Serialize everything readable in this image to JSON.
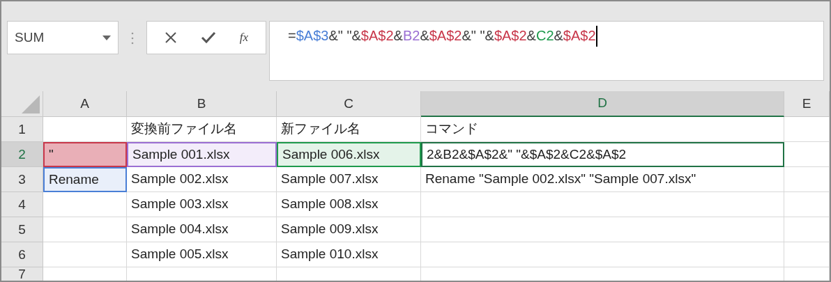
{
  "name_box": {
    "value": "SUM"
  },
  "function_button": {
    "label": "fx"
  },
  "formula": [
    {
      "text": "=",
      "color": "#404040"
    },
    {
      "text": "$A$3",
      "color": "#4a7fd6"
    },
    {
      "text": "&\" \"&",
      "color": "#404040"
    },
    {
      "text": "$A$2",
      "color": "#c8374a"
    },
    {
      "text": "&",
      "color": "#404040"
    },
    {
      "text": "B2",
      "color": "#9b6fd3"
    },
    {
      "text": "&",
      "color": "#404040"
    },
    {
      "text": "$A$2",
      "color": "#c8374a"
    },
    {
      "text": "&\" \"&",
      "color": "#404040"
    },
    {
      "text": "$A$2",
      "color": "#c8374a"
    },
    {
      "text": "&",
      "color": "#404040"
    },
    {
      "text": "C2",
      "color": "#1e9a4c"
    },
    {
      "text": "&",
      "color": "#404040"
    },
    {
      "text": "$A$2",
      "color": "#c8374a"
    }
  ],
  "columns": [
    {
      "label": "A",
      "selected": false
    },
    {
      "label": "B",
      "selected": false
    },
    {
      "label": "C",
      "selected": false
    },
    {
      "label": "D",
      "selected": true
    },
    {
      "label": "E",
      "selected": false
    }
  ],
  "rows": [
    {
      "label": "1",
      "selected": false,
      "cells": [
        {},
        {
          "text": "変換前ファイル名"
        },
        {
          "text": "新ファイル名"
        },
        {
          "text": "コマンド"
        },
        {}
      ]
    },
    {
      "label": "2",
      "selected": true,
      "cells": [
        {
          "text": "\"",
          "color": "#c8374a"
        },
        {
          "text": "Sample 001.xlsx",
          "color": "#9b6fd3"
        },
        {
          "text": "Sample 006.xlsx",
          "color": "#1e9a4c"
        },
        {
          "text": "2&B2&$A$2&\" \"&$A$2&C2&$A$2",
          "selected": true
        },
        {}
      ]
    },
    {
      "label": "3",
      "selected": false,
      "cells": [
        {
          "text": "Rename",
          "color": "#4a7fd6"
        },
        {
          "text": "Sample 002.xlsx"
        },
        {
          "text": "Sample 007.xlsx"
        },
        {
          "text": "Rename \"Sample 002.xlsx\" \"Sample 007.xlsx\""
        },
        {}
      ]
    },
    {
      "label": "4",
      "selected": false,
      "cells": [
        {},
        {
          "text": "Sample 003.xlsx"
        },
        {
          "text": "Sample 008.xlsx"
        },
        {},
        {}
      ]
    },
    {
      "label": "5",
      "selected": false,
      "cells": [
        {},
        {
          "text": "Sample 004.xlsx"
        },
        {
          "text": "Sample 009.xlsx"
        },
        {},
        {}
      ]
    },
    {
      "label": "6",
      "selected": false,
      "cells": [
        {},
        {
          "text": "Sample 005.xlsx"
        },
        {
          "text": "Sample 010.xlsx"
        },
        {},
        {}
      ]
    },
    {
      "label": "7",
      "selected": false,
      "cells": [
        {},
        {},
        {},
        {},
        {}
      ]
    }
  ]
}
